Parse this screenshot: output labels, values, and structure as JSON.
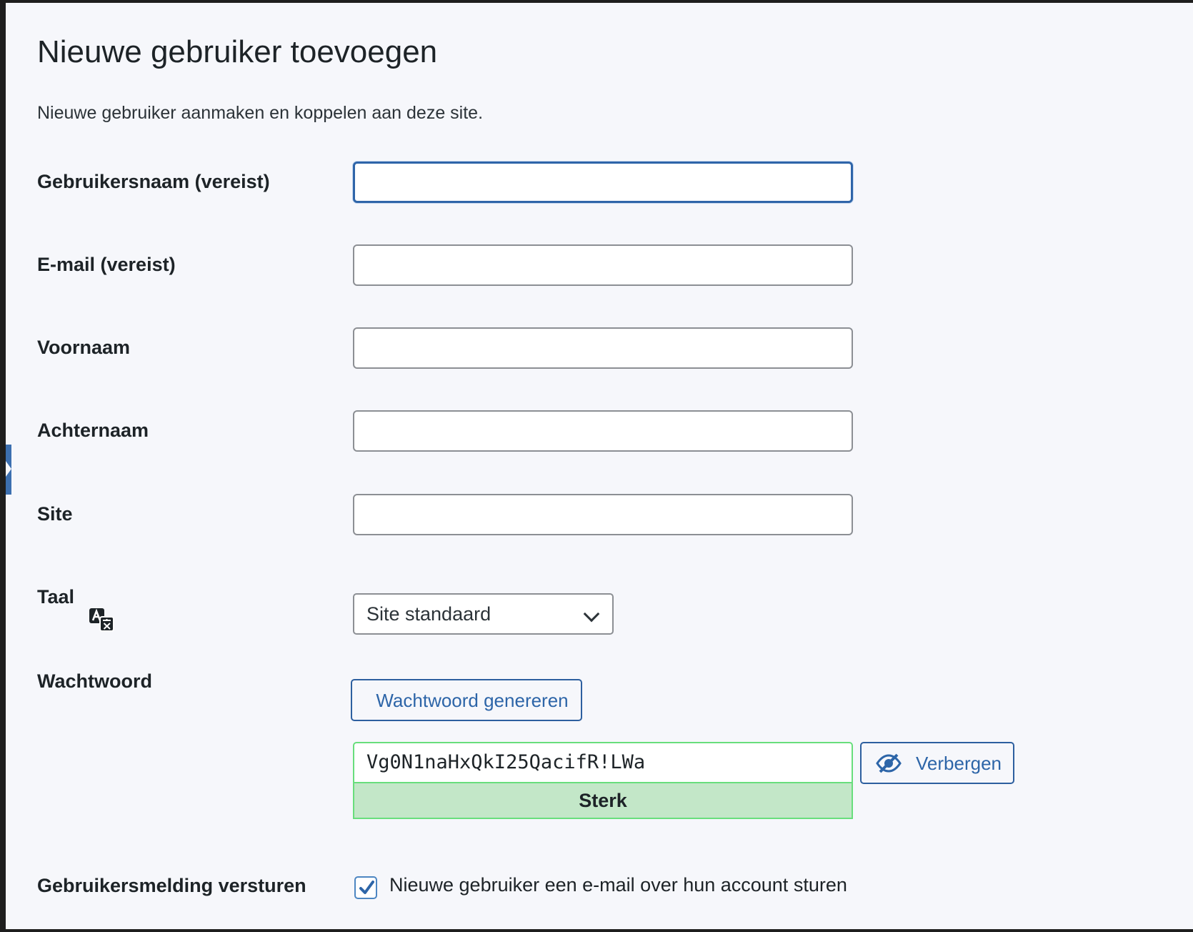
{
  "page": {
    "title": "Nieuwe gebruiker toevoegen",
    "description": "Nieuwe gebruiker aanmaken en koppelen aan deze site."
  },
  "form": {
    "username": {
      "label": "Gebruikersnaam (vereist)",
      "value": ""
    },
    "email": {
      "label": "E-mail (vereist)",
      "value": ""
    },
    "first_name": {
      "label": "Voornaam",
      "value": ""
    },
    "last_name": {
      "label": "Achternaam",
      "value": ""
    },
    "site": {
      "label": "Site",
      "value": ""
    },
    "language": {
      "label": "Taal",
      "selected": "Site standaard",
      "icon": "translate-icon"
    },
    "password": {
      "label": "Wachtwoord",
      "generate_label": "Wachtwoord genereren",
      "value": "Vg0N1naHxQkI25QacifR!LWa",
      "strength": "Sterk",
      "hide_label": "Verbergen",
      "hide_icon": "eye-slash-icon"
    },
    "notification": {
      "label": "Gebruikersmelding versturen",
      "checkbox_label": "Nieuwe gebruiker een e-mail over hun account sturen",
      "checked": true
    }
  },
  "colors": {
    "accent": "#2d65a8",
    "focus_border": "#2f65a9",
    "strong_bg": "#c3e7c8",
    "strong_border": "#68de7c",
    "page_bg": "#f6f7fb"
  }
}
